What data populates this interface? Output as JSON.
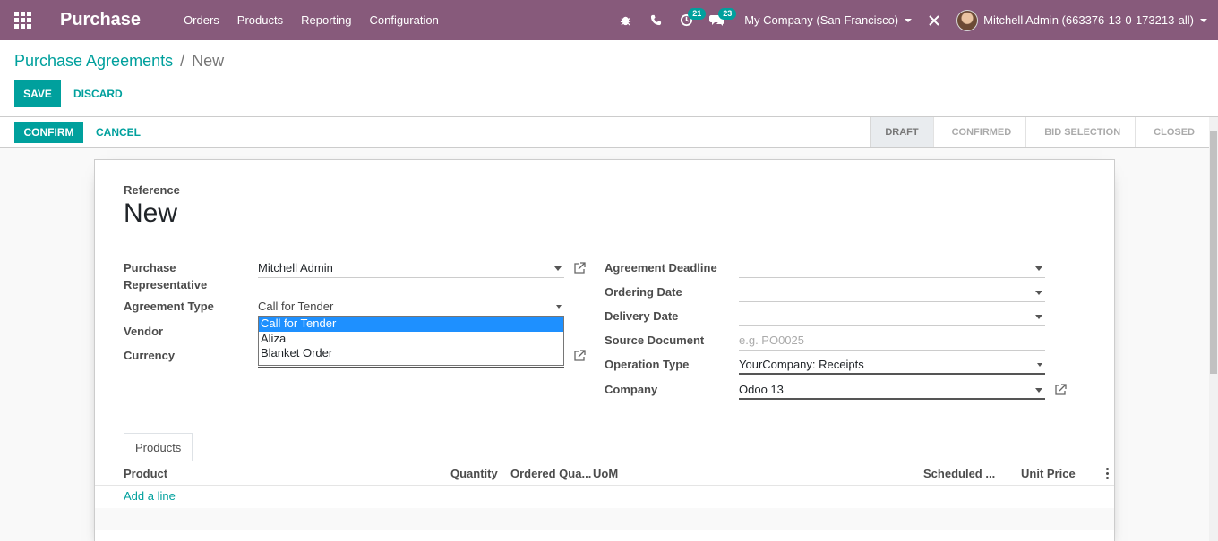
{
  "navbar": {
    "app_name": "Purchase",
    "menus": [
      "Orders",
      "Products",
      "Reporting",
      "Configuration"
    ],
    "activity_count": "21",
    "message_count": "23",
    "company": "My Company (San Francisco)",
    "user": "Mitchell Admin (663376-13-0-173213-all)",
    "bg_color": "#875a7b"
  },
  "breadcrumb": {
    "parent": "Purchase Agreements",
    "separator": "/",
    "current": "New"
  },
  "actions": {
    "save": "Save",
    "discard": "Discard",
    "confirm": "Confirm",
    "cancel": "Cancel"
  },
  "stages": [
    "Draft",
    "Confirmed",
    "Bid Selection",
    "Closed"
  ],
  "form": {
    "reference_label": "Reference",
    "reference_value": "New",
    "left": {
      "rep_label_1": "Purchase",
      "rep_label_2": "Representative",
      "rep_value": "Mitchell Admin",
      "type_label": "Agreement Type",
      "type_value": "Call for Tender",
      "vendor_label": "Vendor",
      "currency_label": "Currency"
    },
    "right": {
      "deadline_label": "Agreement Deadline",
      "ordering_label": "Ordering Date",
      "delivery_label": "Delivery Date",
      "source_label": "Source Document",
      "source_placeholder": "e.g. PO0025",
      "operation_label": "Operation Type",
      "operation_value": "YourCompany: Receipts",
      "company_label": "Company",
      "company_value": "Odoo 13"
    },
    "agreement_type_options": [
      "Call for Tender",
      "Aliza",
      "Blanket Order"
    ]
  },
  "tabs": {
    "products": "Products"
  },
  "lines": {
    "columns": {
      "product": "Product",
      "quantity": "Quantity",
      "ordered": "Ordered Qua...",
      "uom": "UoM",
      "scheduled": "Scheduled ...",
      "unit_price": "Unit Price"
    },
    "add_line": "Add a line"
  }
}
